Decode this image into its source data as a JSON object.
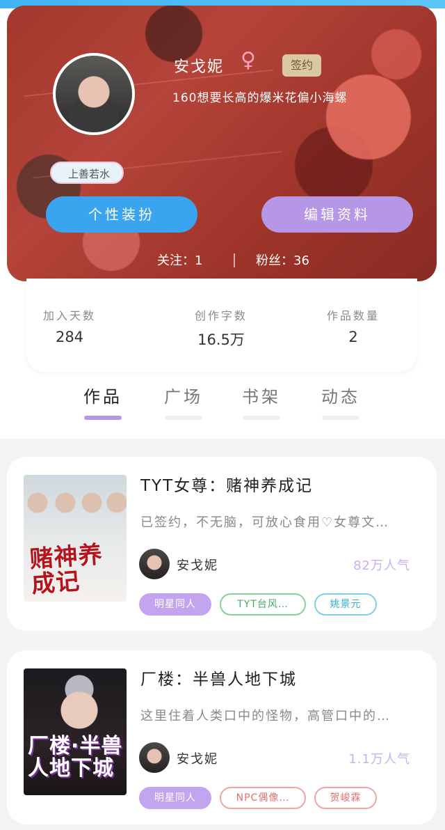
{
  "profile": {
    "name": "安戈妮",
    "gender_symbol": "♀",
    "badge": "签约",
    "bio": "160想要长高的爆米花偏小海螺",
    "tag": "上善若水",
    "dress_button": "个性装扮",
    "edit_button": "编辑资料",
    "following": "关注：1",
    "fans": "粉丝：36"
  },
  "stats": [
    {
      "label": "加入天数",
      "value": "284"
    },
    {
      "label": "创作字数",
      "value": "16.5万"
    },
    {
      "label": "作品数量",
      "value": "2"
    }
  ],
  "tabs": [
    {
      "label": "作品",
      "active": true
    },
    {
      "label": "广场",
      "active": false
    },
    {
      "label": "书架",
      "active": false
    },
    {
      "label": "动态",
      "active": false
    }
  ],
  "works": [
    {
      "title": "TYT女尊：赌神养成记",
      "description": "已签约，不无脑，可放心食用♡女尊文…",
      "author": "安戈妮",
      "popularity": "82万人气",
      "cover_text": "赌神养成记",
      "tags": [
        "明星同人",
        "TYT台风…",
        "姚景元"
      ]
    },
    {
      "title": "厂楼：半兽人地下城",
      "description": "这里住着人类口中的怪物，高管口中的…",
      "author": "安戈妮",
      "popularity": "1.1万人气",
      "cover_text": "厂楼·半兽人地下城",
      "tags": [
        "明星同人",
        "NPC偶像…",
        "贺峻霖"
      ]
    }
  ]
}
